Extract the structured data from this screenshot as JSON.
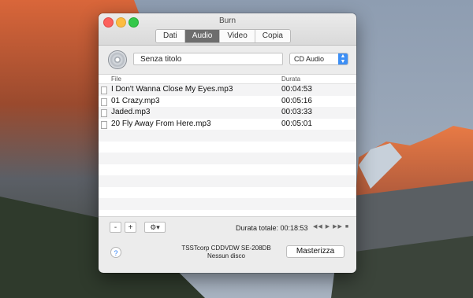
{
  "window": {
    "title": "Burn",
    "tabs": [
      {
        "label": "Dati",
        "active": false
      },
      {
        "label": "Audio",
        "active": true
      },
      {
        "label": "Video",
        "active": false
      },
      {
        "label": "Copia",
        "active": false
      }
    ]
  },
  "disc": {
    "name_value": "Senza titolo",
    "type_selected": "CD Audio"
  },
  "table": {
    "columns": {
      "file": "File",
      "duration": "Durata"
    },
    "rows": [
      {
        "file": "I Don't Wanna Close My Eyes.mp3",
        "duration": "00:04:53"
      },
      {
        "file": "01 Crazy.mp3",
        "duration": "00:05:16"
      },
      {
        "file": "Jaded.mp3",
        "duration": "00:03:33"
      },
      {
        "file": "20 Fly Away From Here.mp3",
        "duration": "00:05:01"
      }
    ]
  },
  "controls": {
    "remove_label": "-",
    "add_label": "+",
    "gear_icon": "gear-icon",
    "total_duration": "Durata totale: 00:18:53",
    "transport_icons": [
      "rewind-icon",
      "play-icon",
      "fast-forward-icon",
      "stop-icon"
    ]
  },
  "footer": {
    "help_label": "?",
    "device_name": "TSSTcorp CDDVDW SE-208DB",
    "device_status": "Nessun disco",
    "burn_label": "Masterizza"
  },
  "colors": {
    "accent": "#3d8ff5",
    "active_tab": "#6d6d6d",
    "close": "#fc605c",
    "minimize": "#fdbc40",
    "maximize": "#34c84a"
  }
}
